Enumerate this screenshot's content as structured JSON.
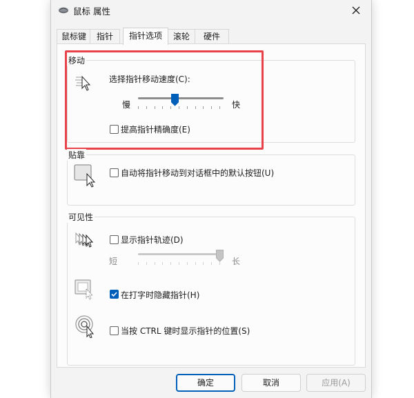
{
  "window": {
    "title": "鼠标 属性"
  },
  "tabs": [
    {
      "label": "鼠标键"
    },
    {
      "label": "指针"
    },
    {
      "label": "指针选项",
      "active": true
    },
    {
      "label": "滚轮"
    },
    {
      "label": "硬件"
    }
  ],
  "motion": {
    "group_label": "移动",
    "speed_label": "选择指针移动速度(C):",
    "slow": "慢",
    "fast": "快",
    "speed_level": 0.45,
    "precision_label": "提高指针精确度(E)",
    "precision_checked": false
  },
  "snap": {
    "group_label": "贴靠",
    "snap_label": "自动将指针移动到对话框中的默认按钮(U)",
    "snap_checked": false
  },
  "visibility": {
    "group_label": "可见性",
    "trails_label": "显示指针轨迹(D)",
    "trails_checked": false,
    "short": "短",
    "long": "长",
    "trails_level": 1.0,
    "hide_label": "在打字时隐藏指针(H)",
    "hide_checked": true,
    "ctrl_label": "当按 CTRL 键时显示指针的位置(S)",
    "ctrl_checked": false
  },
  "buttons": {
    "ok": "确定",
    "cancel": "取消",
    "apply": "应用(A)"
  },
  "colors": {
    "accent": "#005fb8",
    "highlight": "#e9414a"
  }
}
